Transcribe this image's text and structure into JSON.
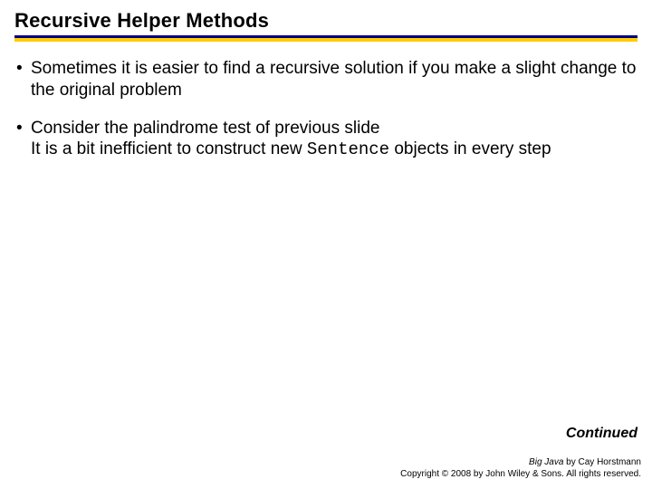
{
  "title": "Recursive Helper Methods",
  "bullets": [
    {
      "text_a": "Sometimes it is easier to find a recursive solution if you make a slight change to the original problem"
    },
    {
      "text_a": "Consider the palindrome test of previous slide",
      "text_b": "It is a bit inefficient to construct new ",
      "code": "Sentence",
      "text_c": " objects in every step"
    }
  ],
  "continued": "Continued",
  "footer": {
    "book": "Big Java",
    "byline": " by Cay Horstmann",
    "copyright": "Copyright © 2008 by John Wiley & Sons.  All rights reserved."
  }
}
